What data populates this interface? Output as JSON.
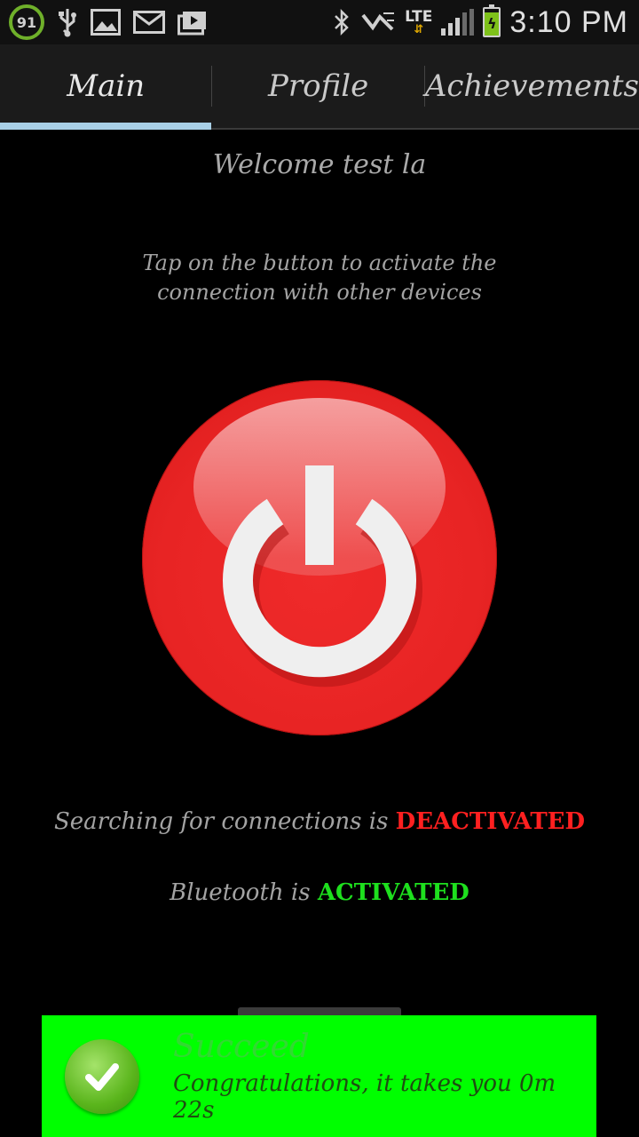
{
  "status_bar": {
    "battery_percent": "91",
    "network": "LTE",
    "time": "3:10 PM",
    "icons": [
      "battery-ring-icon",
      "usb-icon",
      "gallery-icon",
      "email-icon",
      "briefcase-icon",
      "bluetooth-icon",
      "nfc-icon",
      "lte-icon",
      "signal-icon",
      "battery-charging-icon"
    ]
  },
  "tabs": [
    {
      "label": "Main",
      "active": true
    },
    {
      "label": "Profile",
      "active": false
    },
    {
      "label": "Achievements",
      "active": false
    }
  ],
  "main": {
    "welcome": "Welcome test la",
    "instructions": "Tap on the button to activate the connection with other devices",
    "search_prefix": "Searching for connections is ",
    "search_state": "DEACTIVATED",
    "bluetooth_prefix": "Bluetooth is ",
    "bluetooth_state": "ACTIVATED"
  },
  "toast": {
    "title": "Succeed",
    "message": "Congratulations, it takes you 0m 22s"
  },
  "colors": {
    "power_button": "#e82424",
    "deactivated": "#ff2020",
    "activated": "#1ee01e",
    "toast_bg": "#00ff00",
    "tab_indicator": "#a8cfe6"
  }
}
